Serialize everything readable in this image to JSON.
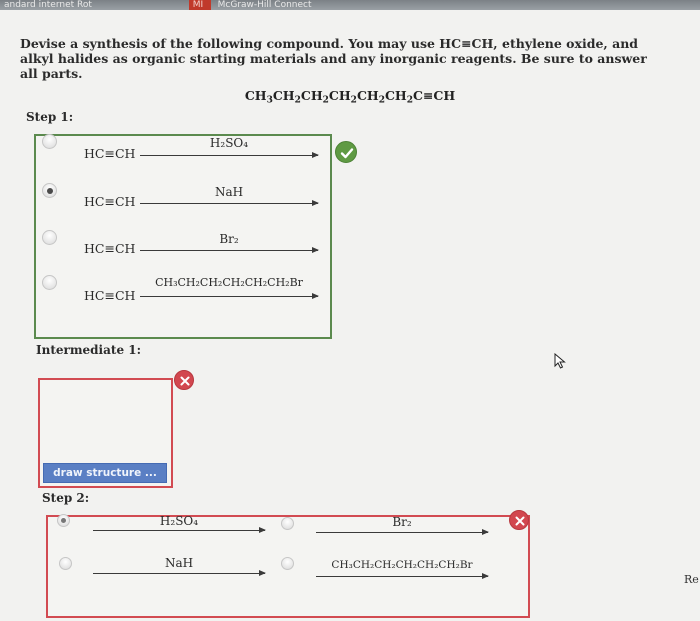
{
  "topbar": {
    "tabs": [
      "andard internet Rot",
      "MI",
      "McGraw-Hill Connect"
    ]
  },
  "question": {
    "text": "Devise a synthesis of the following compound. You may use HC≡CH, ethylene oxide, and alkyl halides as organic starting materials and any inorganic reagents. Be sure to answer all parts.",
    "target_parts": [
      "CH",
      "3",
      "CH",
      "2",
      "CH",
      "2",
      "CH",
      "2",
      "CH",
      "2",
      "CH",
      "2",
      "C≡CH"
    ]
  },
  "step1": {
    "label": "Step 1:",
    "options": [
      {
        "reactant": "HC≡CH",
        "reagent": "H₂SO₄",
        "selected": false
      },
      {
        "reactant": "HC≡CH",
        "reagent": "NaH",
        "selected": true
      },
      {
        "reactant": "HC≡CH",
        "reagent": "Br₂",
        "selected": false
      },
      {
        "reactant": "HC≡CH",
        "reagent": "CH₃CH₂CH₂CH₂CH₂CH₂Br",
        "selected": false
      }
    ],
    "status_icon": "check-icon",
    "status_color": "#5f9a43"
  },
  "intermediate1": {
    "label": "Intermediate 1:",
    "button_label": "draw structure ...",
    "status_icon": "x-icon",
    "status_color": "#d2474f"
  },
  "step2": {
    "label": "Step 2:",
    "options": [
      {
        "reagent": "H₂SO₄",
        "selected": true
      },
      {
        "reagent": "Br₂",
        "selected": false
      },
      {
        "reagent": "NaH",
        "selected": false
      },
      {
        "reagent": "CH₃CH₂CH₂CH₂CH₂CH₂Br",
        "selected": false
      }
    ],
    "status_icon": "x-icon"
  },
  "side_text": "Re"
}
